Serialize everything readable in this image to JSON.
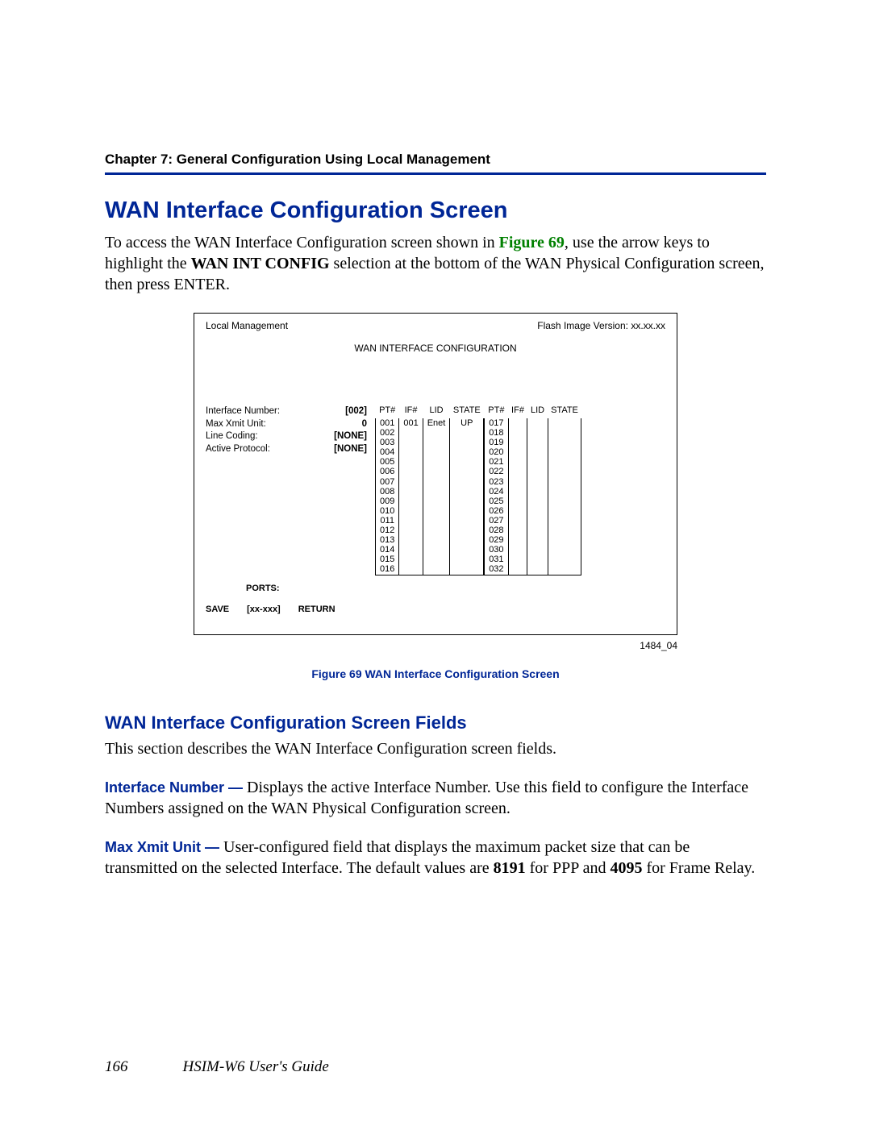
{
  "header": {
    "chapter": "Chapter 7:  General Configuration Using Local Management"
  },
  "section": {
    "title": "WAN Interface Configuration Screen",
    "intro_pre": "To access the WAN Interface Configuration screen shown in ",
    "intro_link": "Figure 69",
    "intro_mid": ", use the arrow keys to highlight the ",
    "intro_bold": "WAN INT CONFIG",
    "intro_post": " selection at the bottom of the WAN Physical Configuration screen, then press ENTER."
  },
  "screenbox": {
    "top_left": "Local Management",
    "top_right": "Flash Image Version: xx.xx.xx",
    "title": "WAN INTERFACE CONFIGURATION",
    "fields": [
      {
        "label": "Interface Number:",
        "value": "[002]"
      },
      {
        "label": "Max Xmit Unit:",
        "value": "0"
      },
      {
        "label": "Line Coding:",
        "value": "[NONE]"
      },
      {
        "label": "Active Protocol:",
        "value": "[NONE]"
      }
    ],
    "headers": [
      "PT#",
      "IF#",
      "LID",
      "STATE"
    ],
    "left_rows": [
      [
        "001",
        "001",
        "Enet",
        "UP"
      ],
      [
        "002",
        "",
        "",
        ""
      ],
      [
        "003",
        "",
        "",
        ""
      ],
      [
        "004",
        "",
        "",
        ""
      ],
      [
        "005",
        "",
        "",
        ""
      ],
      [
        "006",
        "",
        "",
        ""
      ],
      [
        "007",
        "",
        "",
        ""
      ],
      [
        "008",
        "",
        "",
        ""
      ],
      [
        "009",
        "",
        "",
        ""
      ],
      [
        "010",
        "",
        "",
        ""
      ],
      [
        "011",
        "",
        "",
        ""
      ],
      [
        "012",
        "",
        "",
        ""
      ],
      [
        "013",
        "",
        "",
        ""
      ],
      [
        "014",
        "",
        "",
        ""
      ],
      [
        "015",
        "",
        "",
        ""
      ],
      [
        "016",
        "",
        "",
        ""
      ]
    ],
    "right_rows": [
      [
        "017",
        "",
        "",
        ""
      ],
      [
        "018",
        "",
        "",
        ""
      ],
      [
        "019",
        "",
        "",
        ""
      ],
      [
        "020",
        "",
        "",
        ""
      ],
      [
        "021",
        "",
        "",
        ""
      ],
      [
        "022",
        "",
        "",
        ""
      ],
      [
        "023",
        "",
        "",
        ""
      ],
      [
        "024",
        "",
        "",
        ""
      ],
      [
        "025",
        "",
        "",
        ""
      ],
      [
        "026",
        "",
        "",
        ""
      ],
      [
        "027",
        "",
        "",
        ""
      ],
      [
        "028",
        "",
        "",
        ""
      ],
      [
        "029",
        "",
        "",
        ""
      ],
      [
        "030",
        "",
        "",
        ""
      ],
      [
        "031",
        "",
        "",
        ""
      ],
      [
        "032",
        "",
        "",
        ""
      ]
    ],
    "ports_label": "PORTS:",
    "save": "SAVE",
    "range": "[xx-xxx]",
    "return": "RETURN"
  },
  "figure": {
    "id": "1484_04",
    "caption": "Figure 69   WAN Interface Configuration Screen"
  },
  "sub": {
    "title": "WAN Interface Configuration Screen Fields",
    "lead": "This section describes the WAN Interface Configuration screen fields."
  },
  "field1": {
    "name": "Interface Number  —",
    "text": "  Displays the active Interface Number. Use this field to configure the Interface Numbers assigned on the WAN Physical Configuration screen."
  },
  "field2": {
    "name": "Max Xmit Unit  —",
    "text_pre": "  User-configured field that displays the maximum packet size that can be transmitted on the selected Interface. The default values are ",
    "v1": "8191",
    "mid": " for PPP and ",
    "v2": "4095",
    "post": " for Frame Relay."
  },
  "footer": {
    "page": "166",
    "guide": "HSIM-W6 User's Guide"
  }
}
